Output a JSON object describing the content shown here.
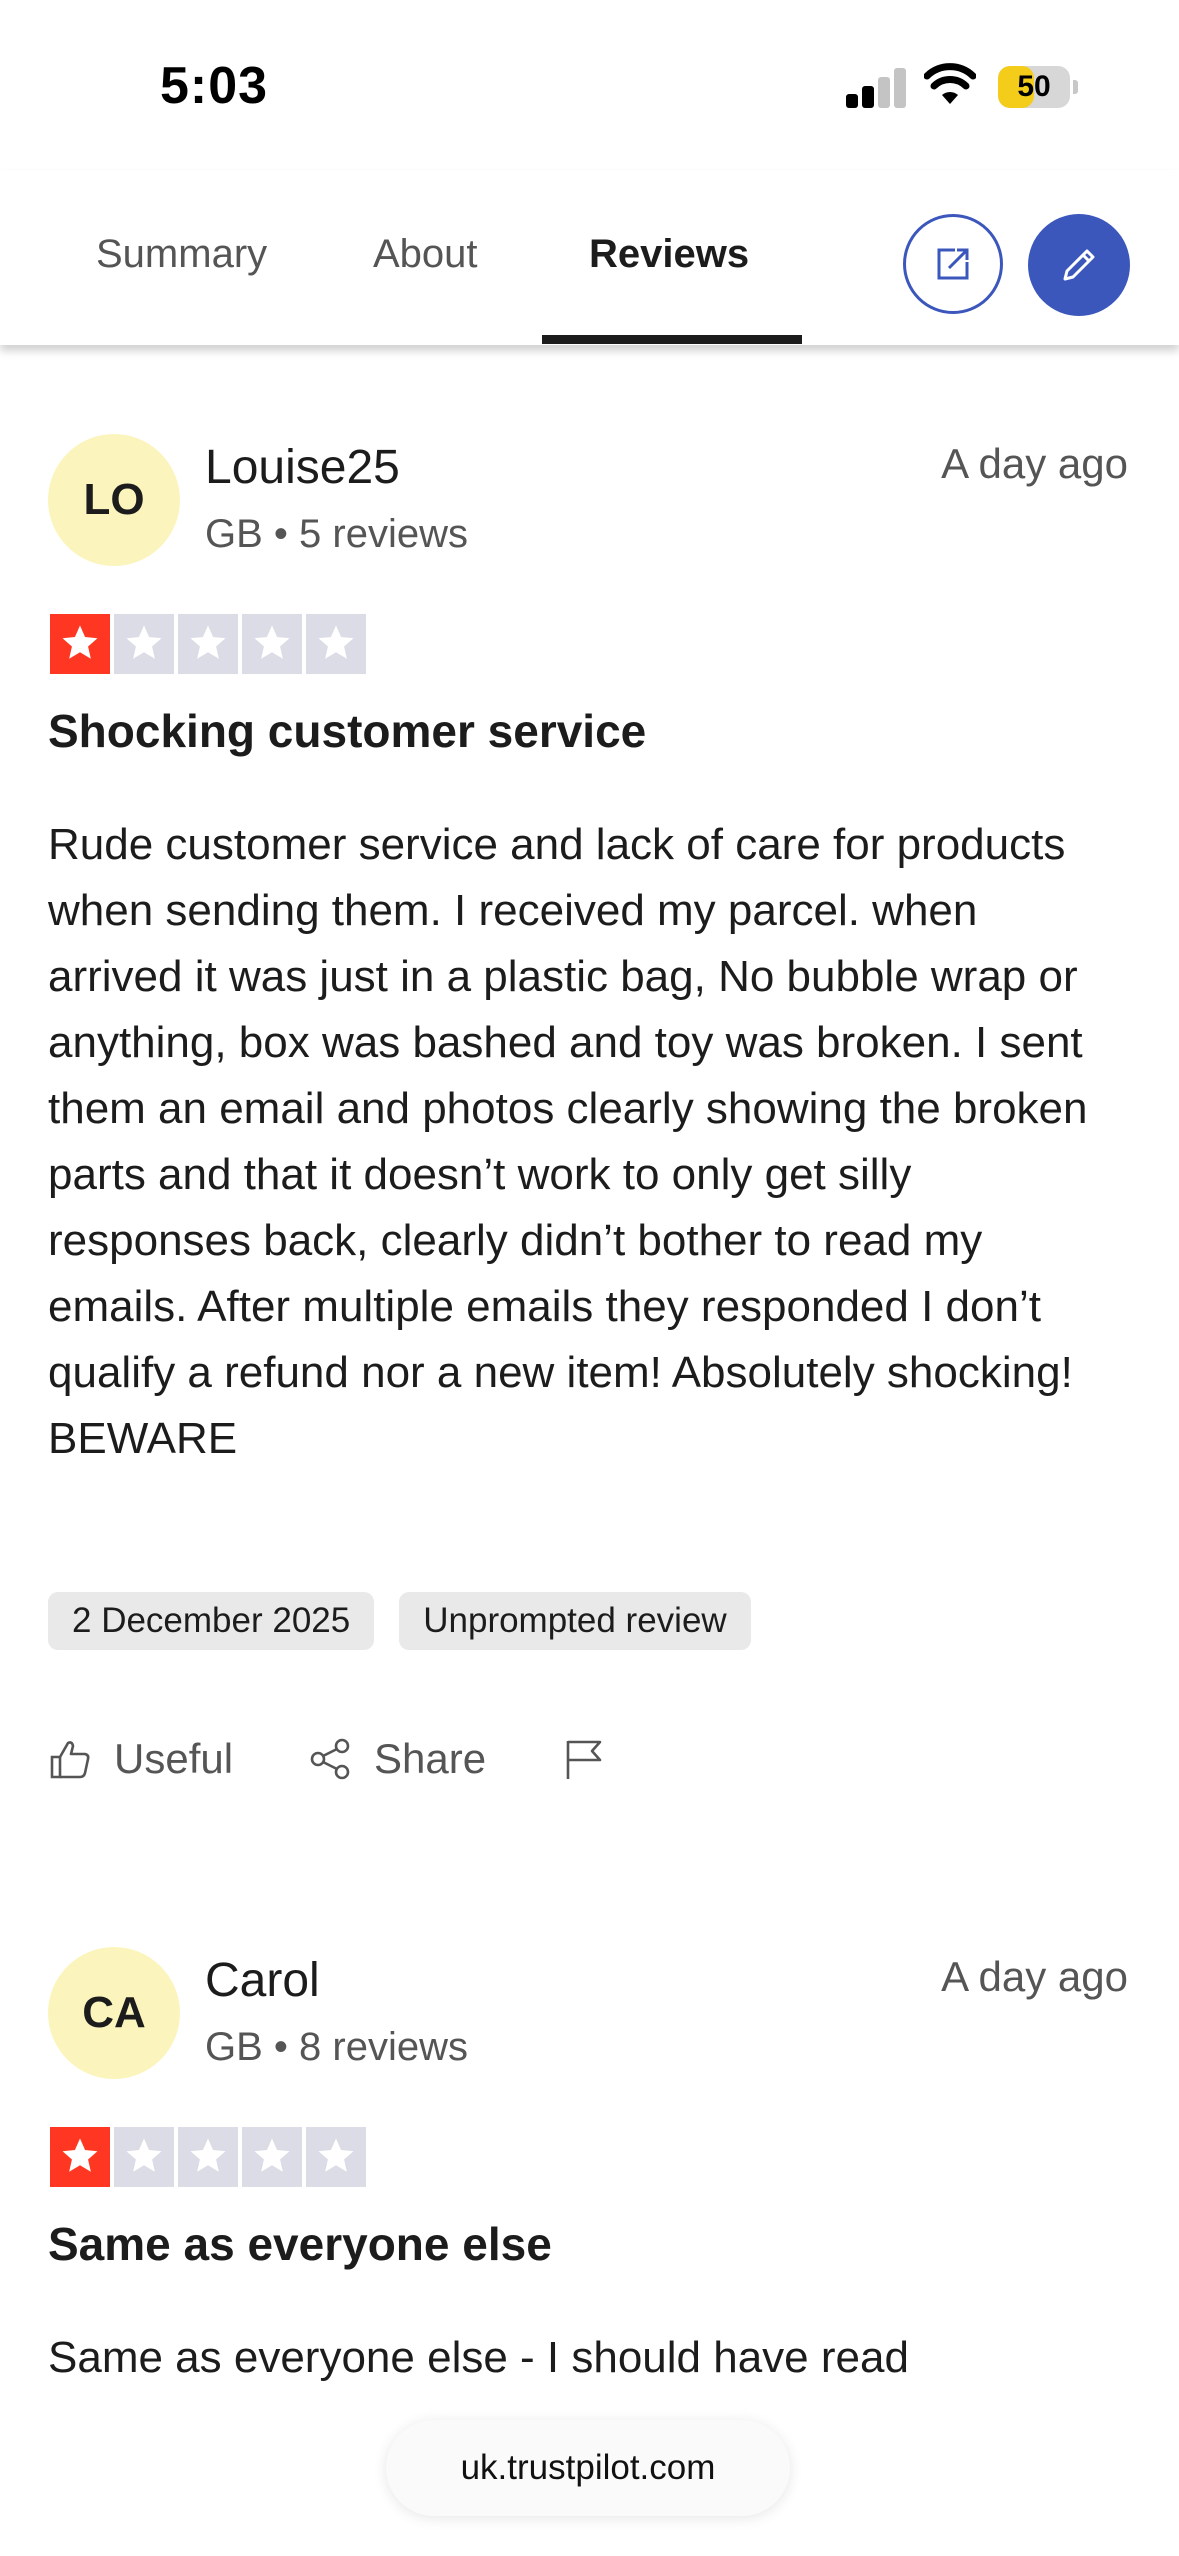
{
  "status_bar": {
    "time": "5:03",
    "battery_level": "50",
    "battery_percent": 50,
    "signal_bars": 2
  },
  "tabs": [
    {
      "label": "Summary",
      "active": false
    },
    {
      "label": "About",
      "active": false
    },
    {
      "label": "Reviews",
      "active": true
    }
  ],
  "header_icons": {
    "external": "external-link-icon",
    "write": "pencil-icon"
  },
  "colors": {
    "accent": "#3c57bc",
    "star_filled": "#ff3722",
    "star_empty": "#dcdce6",
    "avatar_bg": "#fbf5bd"
  },
  "reviews": [
    {
      "initials": "LO",
      "name": "Louise25",
      "meta": "GB • 5 reviews",
      "date_ago": "A day ago",
      "rating": 1,
      "title": "Shocking customer service",
      "body": "Rude customer service and lack of care for products when sending them. I received my parcel. when arrived it was just in a plastic bag, No bubble wrap or anything, box was bashed and toy was broken. I sent them an email and photos clearly showing the broken parts and that it doesn’t work to only get silly responses back, clearly didn’t bother to read my emails. After multiple emails they responded I don’t qualify a refund nor a new item! Absolutely shocking! BEWARE",
      "experience_date": "2 December 2025",
      "badge": "Unprompted review",
      "actions": {
        "useful": "Useful",
        "share": "Share"
      }
    },
    {
      "initials": "CA",
      "name": "Carol",
      "meta": "GB • 8 reviews",
      "date_ago": "A day ago",
      "rating": 1,
      "title": "Same as everyone else",
      "body": "Same as everyone else - I should have read"
    }
  ],
  "url_bar": {
    "domain": "uk.trustpilot.com"
  }
}
